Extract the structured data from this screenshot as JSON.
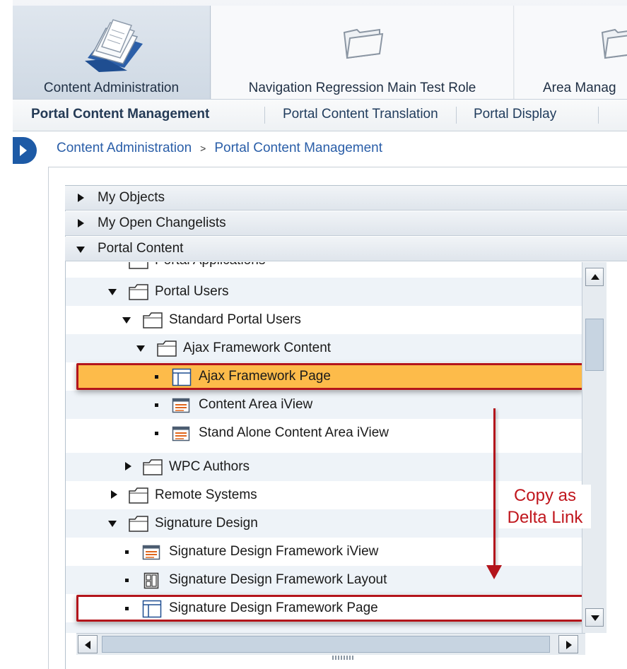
{
  "role_tabs": [
    {
      "label": "Content Administration",
      "icon": "documents-icon",
      "active": true
    },
    {
      "label": "Navigation Regression Main Test Role",
      "icon": "folder-icon",
      "active": false
    },
    {
      "label": "Area Manag",
      "icon": "folder-icon",
      "active": false
    }
  ],
  "sub_nav": [
    {
      "label": "Portal Content Management",
      "active": true
    },
    {
      "label": "Portal Content Translation",
      "active": false
    },
    {
      "label": "Portal Display",
      "active": false
    }
  ],
  "breadcrumb": {
    "items": [
      "Content Administration",
      "Portal Content Management"
    ],
    "separator": ">"
  },
  "trays": [
    {
      "label": "My Objects",
      "expanded": false
    },
    {
      "label": "My Open Changelists",
      "expanded": false
    },
    {
      "label": "Portal Content",
      "expanded": true
    }
  ],
  "tree": {
    "partial_top": "Portal Applications",
    "items": [
      {
        "label": "Portal Users",
        "type": "folder",
        "state": "expanded"
      },
      {
        "label": "Standard Portal Users",
        "type": "folder",
        "state": "expanded"
      },
      {
        "label": "Ajax Framework Content",
        "type": "folder",
        "state": "expanded"
      },
      {
        "label": "Ajax Framework Page",
        "type": "page",
        "state": "leaf",
        "selected": true
      },
      {
        "label": "Content Area iView",
        "type": "iview",
        "state": "leaf"
      },
      {
        "label": "Stand Alone Content Area iView",
        "type": "iview",
        "state": "leaf"
      },
      {
        "label": "WPC Authors",
        "type": "folder",
        "state": "collapsed"
      },
      {
        "label": "Remote Systems",
        "type": "folder",
        "state": "collapsed"
      },
      {
        "label": "Signature Design",
        "type": "folder",
        "state": "expanded"
      },
      {
        "label": "Signature Design Framework iView",
        "type": "iview",
        "state": "leaf"
      },
      {
        "label": "Signature Design Framework Layout",
        "type": "layout",
        "state": "leaf"
      },
      {
        "label": "Signature Design Framework Page",
        "type": "page",
        "state": "leaf",
        "highlighted": true
      }
    ]
  },
  "annotation": {
    "line1": "Copy as",
    "line2": "Delta Link",
    "color": "#c0161d"
  },
  "colors": {
    "selected_row": "#fdbb4a",
    "highlight_border": "#b3141b",
    "link_blue": "#2a5ea8",
    "expander_blue": "#1d5aa6"
  }
}
